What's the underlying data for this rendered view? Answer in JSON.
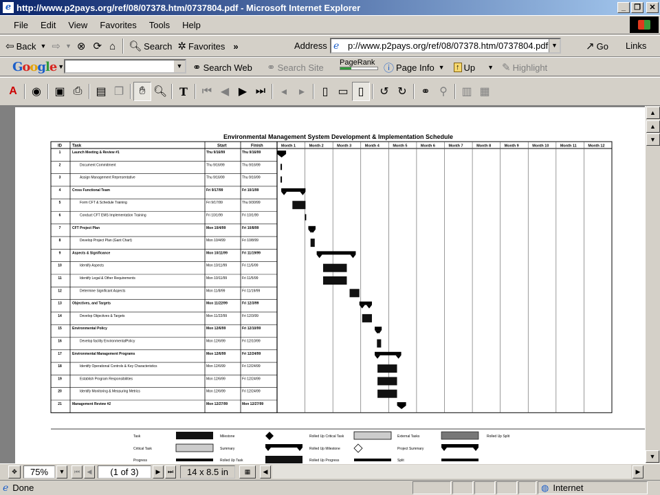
{
  "window": {
    "title": "http://www.p2pays.org/ref/08/07378.htm/0737804.pdf - Microsoft Internet Explorer",
    "controls": [
      "_",
      "❐",
      "✕"
    ]
  },
  "menu": [
    "File",
    "Edit",
    "View",
    "Favorites",
    "Tools",
    "Help"
  ],
  "standard_toolbar": {
    "back": "Back",
    "search": "Search",
    "favorites": "Favorites",
    "address_label": "Address",
    "address_value": "p://www.p2pays.org/ref/08/07378.htm/0737804.pdf",
    "go": "Go",
    "links": "Links"
  },
  "google_toolbar": {
    "logo": "Google",
    "search_web": "Search Web",
    "search_site": "Search Site",
    "pagerank": "PageRank",
    "page_info": "Page Info",
    "up": "Up",
    "highlight": "Highlight"
  },
  "pdf_nav": {
    "zoom": "75%",
    "page_indicator": "(1 of 3)",
    "page_size": "14 x 8.5 in"
  },
  "status": {
    "text": "Done",
    "zone": "Internet"
  },
  "gantt": {
    "title": "Environmental Management System Development & Implementation Schedule",
    "columns": {
      "id": "ID",
      "task": "Task",
      "start": "Start",
      "finish": "Finish"
    },
    "months": [
      "Month 1",
      "Month 2",
      "Month 3",
      "Month 4",
      "Month 5",
      "Month 6",
      "Month 7",
      "Month 8",
      "Month 9",
      "Month 10",
      "Month 11",
      "Month 12"
    ],
    "rows": [
      {
        "id": "1",
        "task": "Launch Meeting & Review #1",
        "start": "Thu 9/16/99",
        "finish": "Thu 9/16/99",
        "summary": true,
        "bar": "milestone",
        "s": 0.15,
        "e": 0.15
      },
      {
        "id": "2",
        "task": "Document Commitment",
        "start": "Thu 9/16/99",
        "finish": "Thu 9/16/99",
        "summary": false,
        "bar": "dash",
        "s": 0.15,
        "e": 0.15
      },
      {
        "id": "3",
        "task": "Assign Management Representative",
        "start": "Thu 9/16/99",
        "finish": "Thu 9/16/99",
        "summary": false,
        "bar": "dash",
        "s": 0.15,
        "e": 0.15
      },
      {
        "id": "4",
        "task": "Cross Functional Team",
        "start": "Fri 9/17/99",
        "finish": "Fri 10/1/99",
        "summary": true,
        "bar": "summary",
        "s": 0.15,
        "e": 1.02
      },
      {
        "id": "5",
        "task": "Form CFT & Schedule Training",
        "start": "Fri 9/17/99",
        "finish": "Thu 9/30/99",
        "summary": false,
        "bar": "task",
        "s": 0.55,
        "e": 1.02
      },
      {
        "id": "6",
        "task": "Conduct CFT EMS Implementation Training",
        "start": "Fri 10/1/99",
        "finish": "Fri 10/1/99",
        "summary": false,
        "bar": "dash",
        "s": 1.02,
        "e": 1.02
      },
      {
        "id": "7",
        "task": "CFT Project Plan",
        "start": "Mon 10/4/99",
        "finish": "Fri 10/8/99",
        "summary": true,
        "bar": "summary",
        "s": 1.12,
        "e": 1.38
      },
      {
        "id": "8",
        "task": "Develop Project Plan (Gant Chart)",
        "start": "Mon 10/4/99",
        "finish": "Fri 10/8/99",
        "summary": false,
        "bar": "task",
        "s": 1.2,
        "e": 1.35
      },
      {
        "id": "9",
        "task": "Aspects & Significance",
        "start": "Mon 10/11/99",
        "finish": "Fri 11/19/99",
        "summary": true,
        "bar": "summary",
        "s": 1.42,
        "e": 2.82
      },
      {
        "id": "10",
        "task": "Identify Aspects",
        "start": "Mon 10/11/99",
        "finish": "Fri 11/5/99",
        "summary": false,
        "bar": "task",
        "s": 1.65,
        "e": 2.5
      },
      {
        "id": "11",
        "task": "Identify Legal & Other Requirements",
        "start": "Mon 10/11/99",
        "finish": "Fri 11/5/99",
        "summary": false,
        "bar": "task",
        "s": 1.65,
        "e": 2.5
      },
      {
        "id": "12",
        "task": "Determine Significant Aspects",
        "start": "Mon 11/8/99",
        "finish": "Fri 11/19/99",
        "summary": false,
        "bar": "task",
        "s": 2.6,
        "e": 2.95
      },
      {
        "id": "13",
        "task": "Objectives, and Targets",
        "start": "Mon 11/22/99",
        "finish": "Fri 12/3/99",
        "summary": true,
        "bar": "summary",
        "s": 2.95,
        "e": 3.4
      },
      {
        "id": "14",
        "task": "Develop Objectives & Targets",
        "start": "Mon 11/22/99",
        "finish": "Fri 12/3/99",
        "summary": false,
        "bar": "task",
        "s": 3.05,
        "e": 3.4
      },
      {
        "id": "15",
        "task": "Environmental Policy",
        "start": "Mon 12/6/99",
        "finish": "Fri 12/10/99",
        "summary": true,
        "bar": "summary",
        "s": 3.5,
        "e": 3.75
      },
      {
        "id": "16",
        "task": "Develop facility EnvironmentalPolicy",
        "start": "Mon 12/6/99",
        "finish": "Fri 12/10/99",
        "summary": false,
        "bar": "task",
        "s": 3.58,
        "e": 3.73
      },
      {
        "id": "17",
        "task": "Environmental Management Programs",
        "start": "Mon 12/6/99",
        "finish": "Fri 12/24/99",
        "summary": true,
        "bar": "summary",
        "s": 3.5,
        "e": 4.45
      },
      {
        "id": "18",
        "task": "Identify Operational Controls & Key Characteristics",
        "start": "Mon 12/6/99",
        "finish": "Fri 12/24/99",
        "summary": false,
        "bar": "task",
        "s": 3.6,
        "e": 4.3
      },
      {
        "id": "19",
        "task": "Establish Program Responsibilities",
        "start": "Mon 12/6/99",
        "finish": "Fri 12/24/99",
        "summary": false,
        "bar": "task",
        "s": 3.6,
        "e": 4.3
      },
      {
        "id": "20",
        "task": "Identify Monitoring & Measuring Metrics",
        "start": "Mon 12/6/99",
        "finish": "Fri 12/24/99",
        "summary": false,
        "bar": "task",
        "s": 3.6,
        "e": 4.3
      },
      {
        "id": "21",
        "task": "Management Review #2",
        "start": "Mon 12/27/99",
        "finish": "Mon 12/27/99",
        "summary": true,
        "bar": "milestone",
        "s": 4.45,
        "e": 4.45
      }
    ],
    "legend": {
      "col1": [
        "Task",
        "Critical Task",
        "Progress"
      ],
      "col2": [
        "Milestone",
        "Summary",
        "Rolled Up Task"
      ],
      "col3": [
        "Rolled Up Critical Task",
        "Rolled Up Milestone",
        "Rolled Up Progress"
      ],
      "col4": [
        "External Tasks",
        "Project Summary",
        "Split"
      ],
      "col5": [
        "Rolled Up Split"
      ]
    }
  }
}
